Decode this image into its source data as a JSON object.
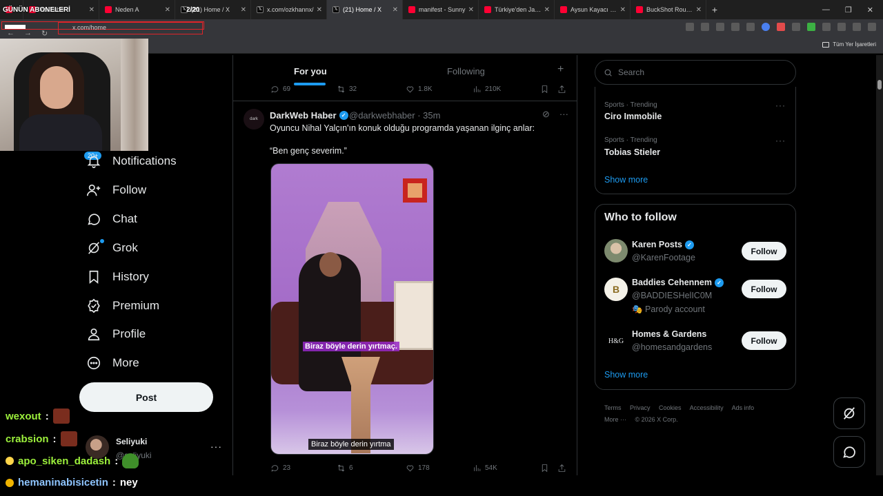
{
  "browser": {
    "tabs": [
      {
        "title": "",
        "icon": "youtube",
        "active": false
      },
      {
        "title": "YouTube",
        "icon": "youtube",
        "active": false
      },
      {
        "title": "Neden A",
        "icon": "youtube",
        "active": false
      },
      {
        "title": "(21) Home / X",
        "icon": "x",
        "active": false
      },
      {
        "title": "x.com/ozkhannx/",
        "icon": "x",
        "active": false
      },
      {
        "title": "(21) Home / X",
        "icon": "x",
        "active": true
      },
      {
        "title": "manifest - Sunny",
        "icon": "youtube",
        "active": false
      },
      {
        "title": "Türkiye'den Japon",
        "icon": "youtube",
        "active": false
      },
      {
        "title": "Aysun Kayacı hak",
        "icon": "youtube",
        "active": false
      },
      {
        "title": "BuckShot Roulett",
        "icon": "youtube",
        "active": false
      }
    ],
    "url": "x.com/home",
    "bookmarks_all": "Tüm Yer İşaretleri"
  },
  "stream_overlay": {
    "title": "GÜNÜN ABONELERİ",
    "count": "2/20"
  },
  "nav": {
    "notifications_badge": "20+",
    "items": [
      {
        "label": "Notifications",
        "icon": "bell-icon"
      },
      {
        "label": "Follow",
        "icon": "person-add-icon"
      },
      {
        "label": "Chat",
        "icon": "chat-icon"
      },
      {
        "label": "Grok",
        "icon": "grok-icon"
      },
      {
        "label": "History",
        "icon": "bookmark-icon"
      },
      {
        "label": "Premium",
        "icon": "verified-badge-icon"
      },
      {
        "label": "Profile",
        "icon": "person-icon"
      },
      {
        "label": "More",
        "icon": "more-circle-icon"
      }
    ],
    "post_label": "Post"
  },
  "account": {
    "name": "Seliyuki",
    "handle": "@seliyuki",
    "more": "···"
  },
  "chat": [
    {
      "user": "wexout",
      "sep": ":",
      "message": ""
    },
    {
      "user": "crabsion",
      "sep": ":",
      "message": ""
    },
    {
      "user": "apo_siken_dadash",
      "sep": ":",
      "message": ""
    },
    {
      "user": "hemaninabisicetin",
      "sep": ":",
      "message": "ney"
    }
  ],
  "feed": {
    "tabs": {
      "for_you": "For you",
      "following": "Following",
      "add": "+"
    },
    "prev_post_stats": {
      "replies": "69",
      "reposts": "32",
      "likes": "1.8K",
      "views": "210K"
    },
    "tweet": {
      "avatar_text": "dark",
      "author": "DarkWeb Haber",
      "handle": "@darkwebhaber · 35m",
      "text": "Oyuncu Nihal Yalçın'ın konuk olduğu programda yaşanan ilginç anlar:",
      "quote": "“Ben genç severim.”",
      "media_caption": "Biraz böyle derin yırtmaç.",
      "media_subtitle": "Biraz böyle derin yırtma",
      "stats": {
        "replies": "23",
        "reposts": "6",
        "likes": "178",
        "views": "54K"
      }
    }
  },
  "sidebar": {
    "search_placeholder": "Search",
    "trends": [
      {
        "meta": "Sports · Trending",
        "name": "Ciro Immobile"
      },
      {
        "meta": "Sports · Trending",
        "name": "Tobias Stieler"
      }
    ],
    "show_more": "Show more",
    "who_to_follow": {
      "title": "Who to follow",
      "users": [
        {
          "name": "Karen Posts",
          "handle": "@KarenFootage",
          "verified": true,
          "extra": "",
          "button": "Follow"
        },
        {
          "name": "Baddies Cehennem",
          "handle": "@BADDIESHelIC0M",
          "verified": true,
          "extra": "Parody account",
          "button": "Follow"
        },
        {
          "name": "Homes & Gardens",
          "handle": "@homesandgardens",
          "verified": false,
          "extra": "",
          "button": "Follow"
        }
      ],
      "show_more": "Show more"
    },
    "footer": [
      "Terms",
      "Privacy",
      "Cookies",
      "Accessibility",
      "Ads info",
      "More ···",
      "© 2026 X Corp."
    ]
  },
  "colors": {
    "accent": "#1d9bf0",
    "background": "#000000",
    "text": "#e7e9ea",
    "muted": "#71767b",
    "border": "#2f3336"
  }
}
